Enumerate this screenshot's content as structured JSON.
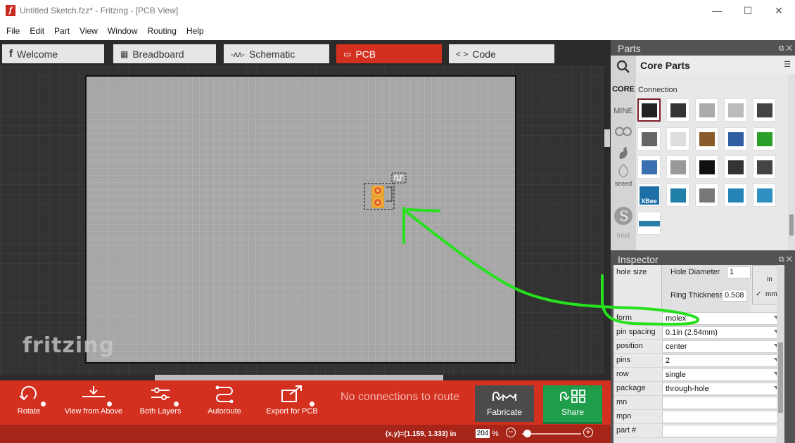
{
  "window": {
    "title": "Untitled Sketch.fzz* - Fritzing - [PCB View]",
    "app_icon": "f",
    "minimize": "—",
    "maximize": "☐",
    "close": "✕"
  },
  "menu": [
    "File",
    "Edit",
    "Part",
    "View",
    "Window",
    "Routing",
    "Help"
  ],
  "tabs": [
    {
      "label": "Welcome",
      "icon": "fritzing-icon",
      "glyph": "f"
    },
    {
      "label": "Breadboard",
      "icon": "breadboard-icon",
      "glyph": "▦"
    },
    {
      "label": "Schematic",
      "icon": "resistor-icon",
      "glyph": "-ᴧᴧ-"
    },
    {
      "label": "PCB",
      "icon": "pcb-icon",
      "glyph": "▭"
    },
    {
      "label": "Code",
      "icon": "code-icon",
      "glyph": "< >"
    }
  ],
  "active_tab": "PCB",
  "canvas": {
    "watermark": "fritzing"
  },
  "toolbar": {
    "rotate": "Rotate",
    "view_from_above": "View from Above",
    "both_layers": "Both Layers",
    "autoroute": "Autoroute",
    "export_for_pcb": "Export for PCB",
    "routing_status": "No connections to route",
    "fabricate": "Fabricate",
    "share": "Share"
  },
  "statusbar": {
    "coordinates": "(x,y)=(1.159, 1.333) in",
    "zoom_value": "204",
    "zoom_unit": "%",
    "zoom_out": "−",
    "zoom_in": "+"
  },
  "parts": {
    "title": "Parts",
    "bin_title": "Core Parts",
    "bin_menu": "☰",
    "section": "Connection",
    "side_tabs": [
      "CORE",
      "MINE"
    ],
    "side_icons": [
      "arduino-icon",
      "sparkfun-icon",
      "seeed-icon",
      "snootlab-icon",
      "intel-icon"
    ],
    "seeed_label": "seeed",
    "intel_label": "intel",
    "grid": [
      "black-header-icon",
      "ribbon-header-icon",
      "molex-connector-icon",
      "jst-connector-icon",
      "power-jack-icon",
      "screw-terminal-icon",
      "white-connector-icon",
      "barrel-connector-icon",
      "blue-terminal-icon",
      "green-terminal-icon",
      "db9-connector-icon",
      "usb-connector-icon",
      "din-connector-icon",
      "usb-b-connector-icon",
      "audio-jack-icon",
      "xbee-icon",
      "arduino-board-icon",
      "ftdi-board-icon",
      "shield-board-icon",
      "breadboard-mini-icon",
      "pin-strip-icon"
    ],
    "xbee_label": "XBee"
  },
  "inspector": {
    "title": "Inspector",
    "hole_size_label": "hole size",
    "hole_diameter_label": "Hole Diameter",
    "hole_diameter_value": "1",
    "ring_thickness_label": "Ring Thickness",
    "ring_thickness_value": "0.508",
    "unit_in": "in",
    "unit_mm": "mm",
    "unit_check": "✓",
    "properties": [
      {
        "label": "form",
        "value": "molex",
        "dropdown": true
      },
      {
        "label": "pin spacing",
        "value": "0.1in (2.54mm)",
        "dropdown": true
      },
      {
        "label": "position",
        "value": "center",
        "dropdown": true
      },
      {
        "label": "pins",
        "value": "2",
        "dropdown": true
      },
      {
        "label": "row",
        "value": "single",
        "dropdown": true
      },
      {
        "label": "package",
        "value": "through-hole",
        "dropdown": true
      },
      {
        "label": "mn",
        "value": "",
        "dropdown": false
      },
      {
        "label": "mpn",
        "value": "",
        "dropdown": false
      },
      {
        "label": "part #",
        "value": "",
        "dropdown": false
      }
    ]
  },
  "colors": {
    "accent_red": "#d4301f",
    "share_green": "#1e9d4b",
    "annotation_green": "#27e01e"
  }
}
